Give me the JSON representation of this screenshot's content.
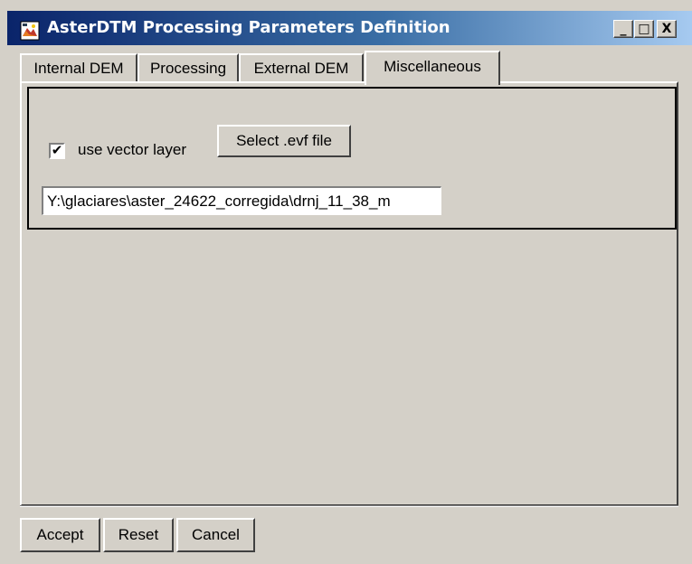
{
  "window": {
    "title": "AsterDTM Processing Parameters Definition",
    "title_bar_start_color": "#0a246a",
    "title_bar_end_color": "#a6caf0",
    "face_color": "#d4d0c8",
    "controls": {
      "minimize": "_",
      "maximize": "□",
      "close": "X"
    }
  },
  "tabs": [
    {
      "label": "Internal DEM",
      "selected": false
    },
    {
      "label": "Processing",
      "selected": false
    },
    {
      "label": "External DEM",
      "selected": false
    },
    {
      "label": "Miscellaneous",
      "selected": true
    }
  ],
  "miscellaneous": {
    "use_vector_layer": {
      "label": "use vector layer",
      "checked": true,
      "check_glyph": "✔"
    },
    "select_button_label": "Select .evf file",
    "file_path_value": "Y:\\glaciares\\aster_24622_corregida\\drnj_11_38_m"
  },
  "footer": {
    "accept_label": "Accept",
    "reset_label": "Reset",
    "cancel_label": "Cancel"
  },
  "icons": {
    "app": "app-icon"
  }
}
